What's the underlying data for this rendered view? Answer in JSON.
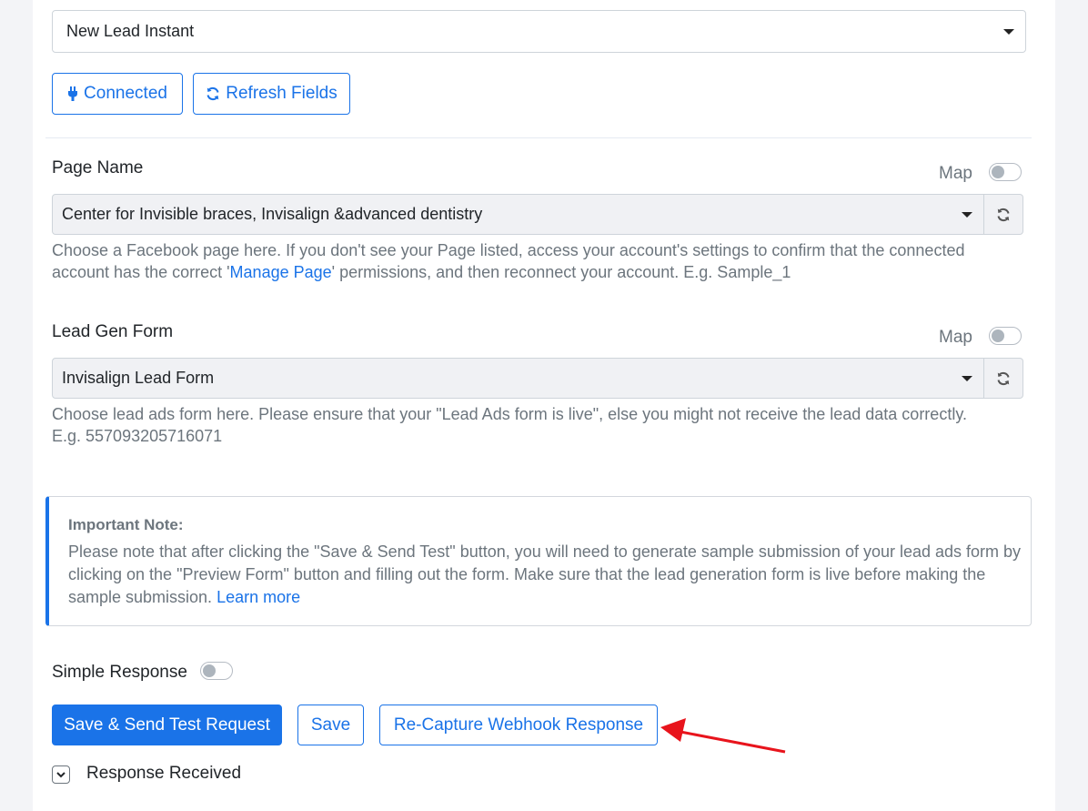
{
  "trigger_event": {
    "value": "New Lead Instant"
  },
  "connection": {
    "connected_label": "Connected",
    "refresh_label": "Refresh Fields"
  },
  "page_name": {
    "label": "Page Name",
    "map_label": "Map",
    "value": "Center for Invisible braces, Invisalign &advanced dentistry",
    "help_part1": "Choose a Facebook page here. If you don't see your Page listed, access your account's settings to confirm that the connected account has the correct '",
    "help_link": "Manage Page",
    "help_part2": "' permissions, and then reconnect your account. E.g. Sample_1"
  },
  "lead_gen_form": {
    "label": "Lead Gen Form",
    "map_label": "Map",
    "value": "Invisalign Lead Form",
    "help": "Choose lead ads form here. Please ensure that your \"Lead Ads form is live\", else you might not receive the lead data correctly. E.g. 557093205716071"
  },
  "note": {
    "title": "Important Note:",
    "body": "Please note that after clicking the \"Save & Send Test\" button, you will need to generate sample submission of your lead ads form by clicking on the \"Preview Form\" button and filling out the form. Make sure that the lead generation form is live before making the sample submission. ",
    "link": "Learn more"
  },
  "simple_response": {
    "label": "Simple Response"
  },
  "actions": {
    "save_send_test": "Save & Send Test Request",
    "save": "Save",
    "recapture": "Re-Capture Webhook Response"
  },
  "response_received": {
    "label": "Response Received"
  },
  "colors": {
    "accent": "#1a73e8",
    "annotation_arrow": "#e8141c"
  }
}
